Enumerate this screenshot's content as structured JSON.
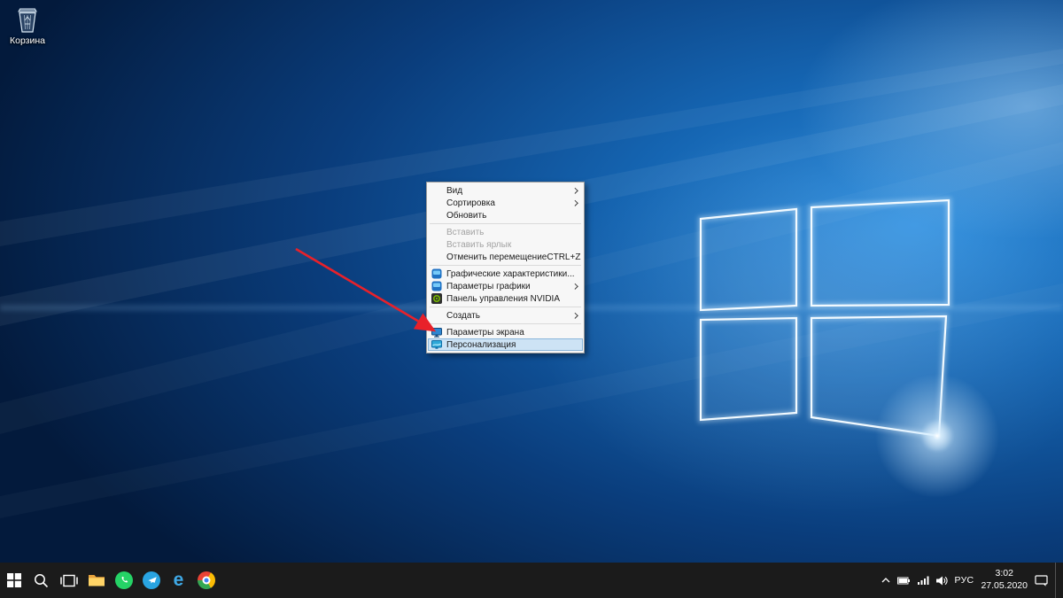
{
  "desktop": {
    "recycle_bin_label": "Корзина"
  },
  "context_menu": {
    "items": [
      {
        "label": "Вид",
        "submenu": true
      },
      {
        "label": "Сортировка",
        "submenu": true
      },
      {
        "label": "Обновить"
      },
      {
        "label": "Вставить",
        "disabled": true
      },
      {
        "label": "Вставить ярлык",
        "disabled": true
      },
      {
        "label": "Отменить перемещение",
        "shortcut": "CTRL+Z"
      },
      {
        "label": "Графические характеристики...",
        "icon": "intel-graphics-icon"
      },
      {
        "label": "Параметры графики",
        "icon": "intel-graphics-icon",
        "submenu": true
      },
      {
        "label": "Панель управления NVIDIA",
        "icon": "nvidia-icon"
      },
      {
        "label": "Создать",
        "submenu": true
      },
      {
        "label": "Параметры экрана",
        "icon": "display-settings-icon"
      },
      {
        "label": "Персонализация",
        "icon": "personalization-icon",
        "highlighted": true
      }
    ]
  },
  "taskbar": {
    "tray": {
      "language": "РУС",
      "time": "3:02",
      "date": "27.05.2020"
    },
    "icons": {
      "edge_glyph": "e",
      "names": [
        "start-icon",
        "search-icon",
        "task-view-icon",
        "file-explorer-icon",
        "whatsapp-icon",
        "telegram-icon",
        "edge-icon",
        "chrome-icon",
        "tray-chevron-up-icon",
        "battery-icon",
        "network-icon",
        "volume-icon",
        "action-center-icon"
      ]
    }
  },
  "annotation": {
    "type": "red-arrow",
    "points_to": "Персонализация"
  },
  "colors": {
    "taskbar_bg": "#1b1b1b",
    "menu_bg": "#f7f7f7",
    "menu_highlight": "#cde3f5",
    "arrow_red": "#e8212a",
    "whatsapp_green": "#25d366",
    "telegram_blue": "#29a4e2",
    "folder_yellow": "#fcb827",
    "nvidia_green": "#76b900",
    "chrome_red": "#ea4335",
    "chrome_yellow": "#fbbc05",
    "chrome_green": "#34a853",
    "chrome_blue": "#4285f4",
    "wallpaper_blue": "#1565b2"
  }
}
